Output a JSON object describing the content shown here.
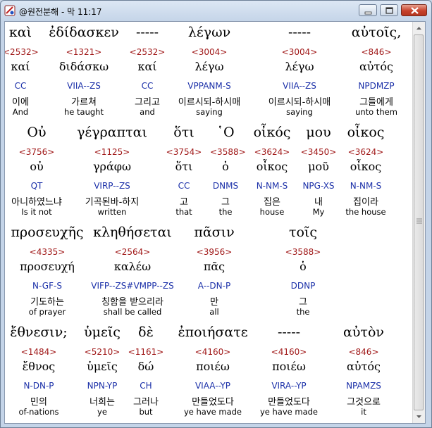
{
  "window": {
    "title": "@원전분해 - 막 11:17"
  },
  "rows": [
    {
      "words": [
        {
          "greek": "καὶ",
          "strong": "<2532>",
          "lemma": "καί",
          "parse": "CC",
          "korean": "이에",
          "english": "And"
        },
        {
          "greek": "ἐδίδασκεν",
          "strong": "<1321>",
          "lemma": "διδάσκω",
          "parse": "VIIA--ZS",
          "korean": "가르쳐",
          "english": "he taught"
        },
        {
          "greek": "-----",
          "strong": "<2532>",
          "lemma": "καί",
          "parse": "CC",
          "korean": "그리고",
          "english": "and"
        },
        {
          "greek": "λέγων",
          "strong": "<3004>",
          "lemma": "λέγω",
          "parse": "VPPANM-S",
          "korean": "이르시되-하시매",
          "english": "saying"
        },
        {
          "greek": "-----",
          "strong": "<3004>",
          "lemma": "λέγω",
          "parse": "VIIA--ZS",
          "korean": "이르시되-하시매",
          "english": "saying"
        },
        {
          "greek": "αὐτοῖς,",
          "strong": "<846>",
          "lemma": "αὐτός",
          "parse": "NPDMZP",
          "korean": "그들에게",
          "english": "unto them"
        }
      ]
    },
    {
      "words": [
        {
          "greek": "Οὐ",
          "strong": "<3756>",
          "lemma": "οὐ",
          "parse": "QT",
          "korean": "아니하였느냐",
          "english": "Is it not"
        },
        {
          "greek": "γέγραπται",
          "strong": "<1125>",
          "lemma": "γράφω",
          "parse": "VIRP--ZS",
          "korean": "기곡된바-하지",
          "english": "written"
        },
        {
          "greek": "ὅτι",
          "strong": "<3754>",
          "lemma": "ὅτι",
          "parse": "CC",
          "korean": "고",
          "english": "that"
        },
        {
          "greek": "῾Ο",
          "strong": "<3588>",
          "lemma": "ὁ",
          "parse": "DNMS",
          "korean": "그",
          "english": "the"
        },
        {
          "greek": "οἶκός",
          "strong": "<3624>",
          "lemma": "οἶκος",
          "parse": "N-NM-S",
          "korean": "집은",
          "english": "house"
        },
        {
          "greek": "μου",
          "strong": "<3450>",
          "lemma": "μοῦ",
          "parse": "NPG-XS",
          "korean": "내",
          "english": "My"
        },
        {
          "greek": "οἶκος",
          "strong": "<3624>",
          "lemma": "οἶκος",
          "parse": "N-NM-S",
          "korean": "집이라",
          "english": "the house"
        }
      ]
    },
    {
      "words": [
        {
          "greek": "προσευχῆς",
          "strong": "<4335>",
          "lemma": "προσευχή",
          "parse": "N-GF-S",
          "korean": "기도하는",
          "english": "of prayer"
        },
        {
          "greek": "κληθήσεται",
          "strong": "<2564>",
          "lemma": "καλέω",
          "parse": "VIFP--ZS#VMPP--ZS",
          "korean": "칭함을 받으리라",
          "english": "shall be called"
        },
        {
          "greek": "πᾶσιν",
          "strong": "<3956>",
          "lemma": "πᾶς",
          "parse": "A--DN-P",
          "korean": "만",
          "english": "all"
        },
        {
          "greek": "τοῖς",
          "strong": "<3588>",
          "lemma": "ὁ",
          "parse": "DDNP",
          "korean": "그",
          "english": "the"
        }
      ]
    },
    {
      "words": [
        {
          "greek": "ἔθνεσιν;",
          "strong": "<1484>",
          "lemma": "ἔθνος",
          "parse": "N-DN-P",
          "korean": "민의",
          "english": "of-nations"
        },
        {
          "greek": "ὑμεῖς",
          "strong": "<5210>",
          "lemma": "ὑμεῖς",
          "parse": "NPN-YP",
          "korean": "너희는",
          "english": "ye"
        },
        {
          "greek": "δὲ",
          "strong": "<1161>",
          "lemma": "δώ",
          "parse": "CH",
          "korean": "그러나",
          "english": "but"
        },
        {
          "greek": "ἐποιήσατε",
          "strong": "<4160>",
          "lemma": "ποιέω",
          "parse": "VIAA--YP",
          "korean": "만들었도다",
          "english": "ye have made"
        },
        {
          "greek": "-----",
          "strong": "<4160>",
          "lemma": "ποιέω",
          "parse": "VIRA--YP",
          "korean": "만들었도다",
          "english": "ye have made"
        },
        {
          "greek": "αὐτὸν",
          "strong": "<846>",
          "lemma": "αὐτός",
          "parse": "NPAMZS",
          "korean": "그것으로",
          "english": "it"
        }
      ]
    }
  ],
  "colors": {
    "strong": "#a01818",
    "parse": "#1a2fa8",
    "text": "#000000"
  },
  "icons": {
    "app": "bible-app-icon",
    "minimize": "minimize-icon",
    "maximize": "maximize-icon",
    "close": "close-icon"
  }
}
